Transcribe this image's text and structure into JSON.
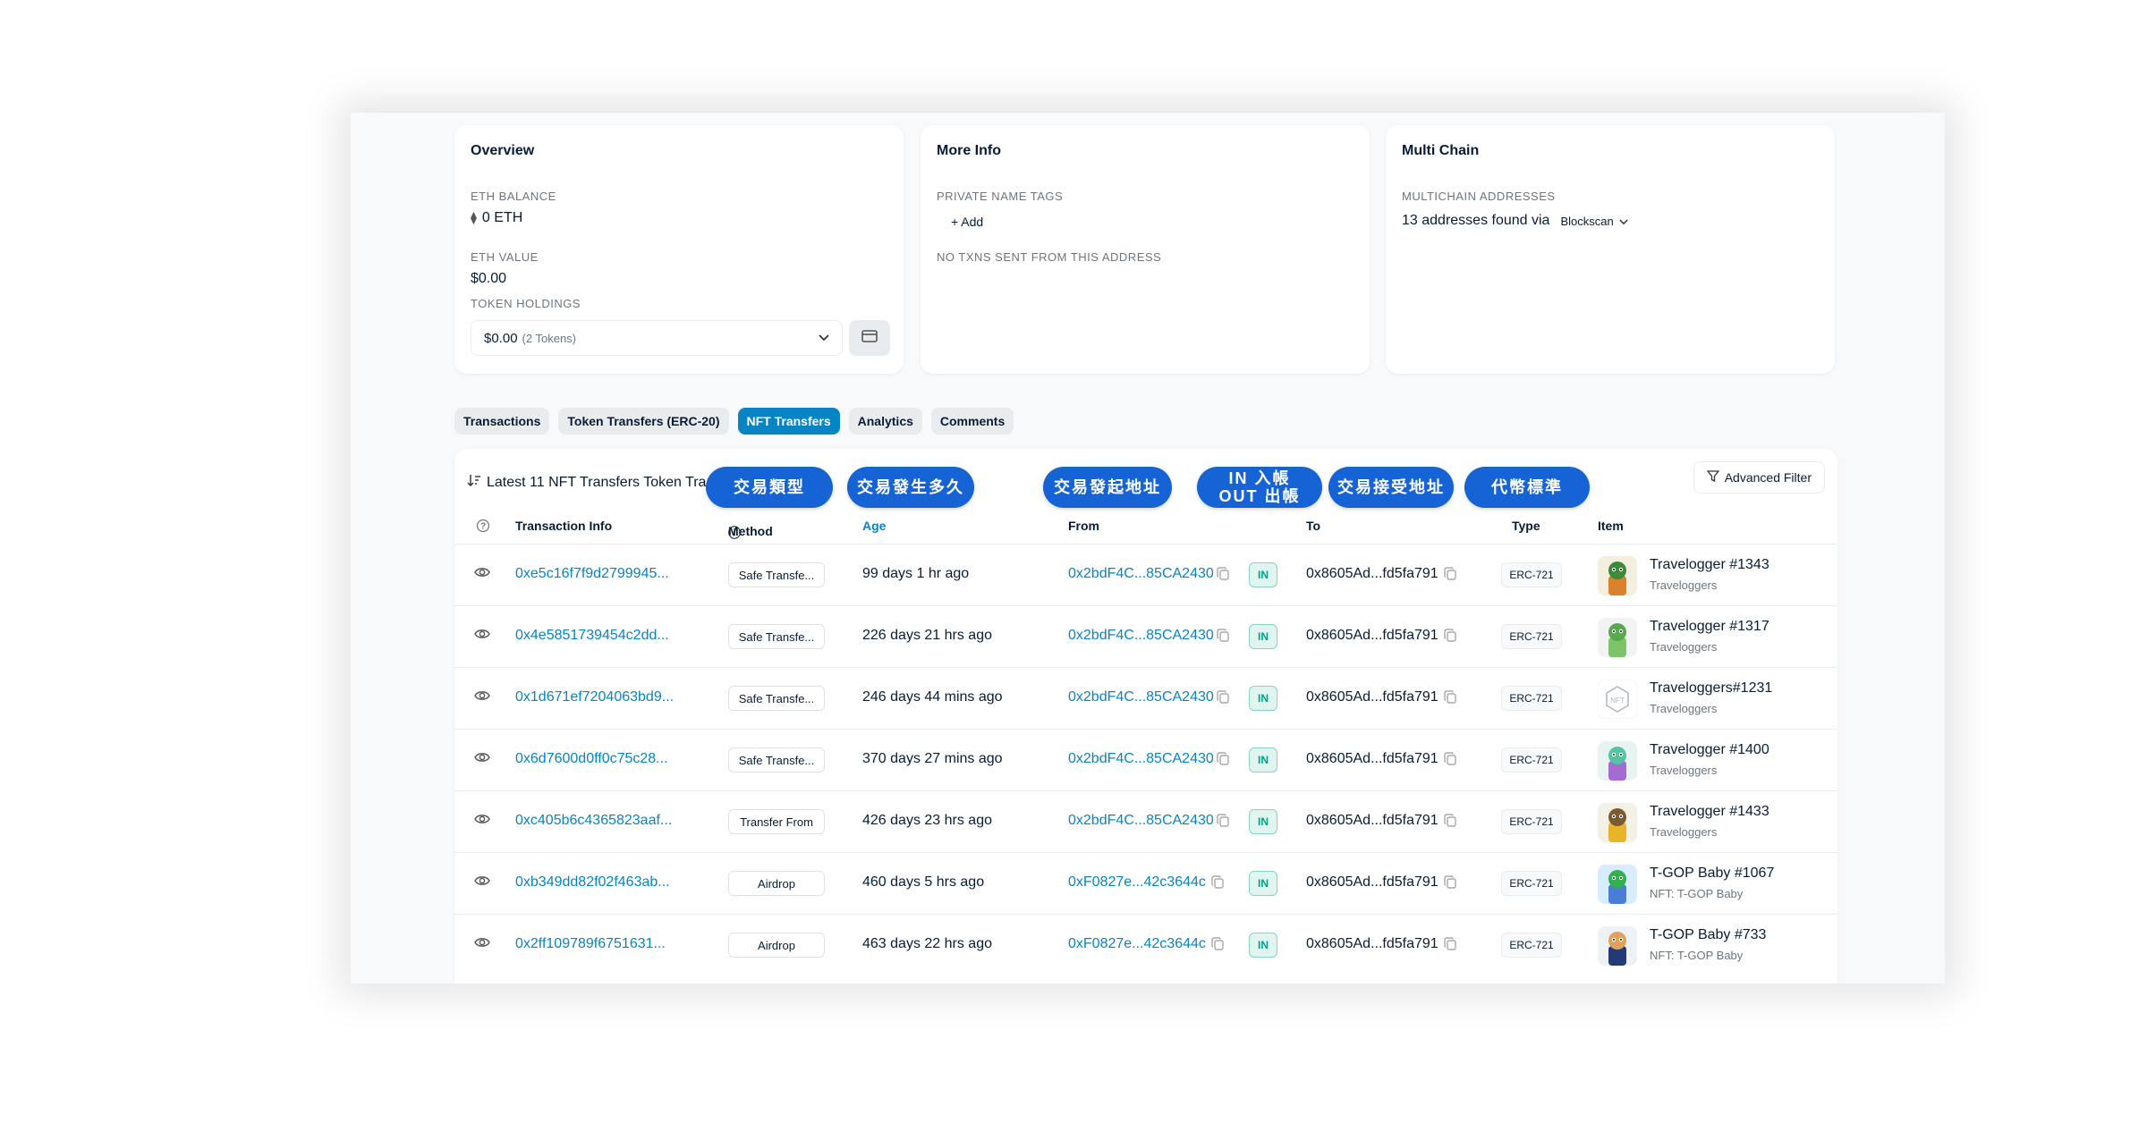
{
  "overview": {
    "title": "Overview",
    "eth_balance_label": "ETH BALANCE",
    "eth_balance": "0 ETH",
    "eth_value_label": "ETH VALUE",
    "eth_value": "$0.00",
    "token_holdings_label": "TOKEN HOLDINGS",
    "token_holdings_value": "$0.00",
    "token_holdings_count": "(2 Tokens)"
  },
  "more_info": {
    "title": "More Info",
    "private_tags_label": "PRIVATE NAME TAGS",
    "add_label": "+ Add",
    "no_txns": "NO TXNS SENT FROM THIS ADDRESS"
  },
  "multi_chain": {
    "title": "Multi Chain",
    "addresses_label": "MULTICHAIN ADDRESSES",
    "found_text": "13 addresses found via",
    "source": "Blockscan"
  },
  "tabs": [
    "Transactions",
    "Token Transfers (ERC-20)",
    "NFT Transfers",
    "Analytics",
    "Comments"
  ],
  "active_tab": "NFT Transfers",
  "panel": {
    "latest_text": "Latest 11 NFT Transfers Token Tra",
    "advanced_filter": "Advanced Filter"
  },
  "annotations": [
    "交易類型",
    "交易發生多久",
    "交易發起地址",
    "IN 入帳\nOUT 出帳",
    "交易接受地址",
    "代幣標準"
  ],
  "table_headers": {
    "info": "?",
    "tx_info": "Transaction Info",
    "method": "Method",
    "age": "Age",
    "from": "From",
    "to": "To",
    "type": "Type",
    "item": "Item"
  },
  "rows": [
    {
      "hash": "0xe5c16f7f9d2799945...",
      "method": "Safe Transfe...",
      "age": "99 days 1 hr ago",
      "from": "0x2bdF4C...85CA2430",
      "dir": "IN",
      "to": "0x8605Ad...fd5fa791",
      "type": "ERC-721",
      "item_name": "Travelogger #1343",
      "item_collection": "Traveloggers"
    },
    {
      "hash": "0x4e5851739454c2dd...",
      "method": "Safe Transfe...",
      "age": "226 days 21 hrs ago",
      "from": "0x2bdF4C...85CA2430",
      "dir": "IN",
      "to": "0x8605Ad...fd5fa791",
      "type": "ERC-721",
      "item_name": "Travelogger #1317",
      "item_collection": "Traveloggers"
    },
    {
      "hash": "0x1d671ef7204063bd9...",
      "method": "Safe Transfe...",
      "age": "246 days 44 mins ago",
      "from": "0x2bdF4C...85CA2430",
      "dir": "IN",
      "to": "0x8605Ad...fd5fa791",
      "type": "ERC-721",
      "item_name": "Traveloggers#1231",
      "item_collection": "Traveloggers"
    },
    {
      "hash": "0x6d7600d0ff0c75c28...",
      "method": "Safe Transfe...",
      "age": "370 days 27 mins ago",
      "from": "0x2bdF4C...85CA2430",
      "dir": "IN",
      "to": "0x8605Ad...fd5fa791",
      "type": "ERC-721",
      "item_name": "Travelogger #1400",
      "item_collection": "Traveloggers"
    },
    {
      "hash": "0xc405b6c4365823aaf...",
      "method": "Transfer From",
      "age": "426 days 23 hrs ago",
      "from": "0x2bdF4C...85CA2430",
      "dir": "IN",
      "to": "0x8605Ad...fd5fa791",
      "type": "ERC-721",
      "item_name": "Travelogger #1433",
      "item_collection": "Traveloggers"
    },
    {
      "hash": "0xb349dd82f02f463ab...",
      "method": "Airdrop",
      "age": "460 days 5 hrs ago",
      "from": "0xF0827e...42c3644c",
      "dir": "IN",
      "to": "0x8605Ad...fd5fa791",
      "type": "ERC-721",
      "item_name": "T-GOP Baby #1067",
      "item_collection": "NFT: T-GOP Baby"
    },
    {
      "hash": "0x2ff109789f6751631...",
      "method": "Airdrop",
      "age": "463 days 22 hrs ago",
      "from": "0xF0827e...42c3644c",
      "dir": "IN",
      "to": "0x8605Ad...fd5fa791",
      "type": "ERC-721",
      "item_name": "T-GOP Baby #733",
      "item_collection": "NFT: T-GOP Baby"
    }
  ],
  "colors": {
    "accent": "#0784c3",
    "pill": "#1663d6",
    "in_badge": "#00a186"
  }
}
